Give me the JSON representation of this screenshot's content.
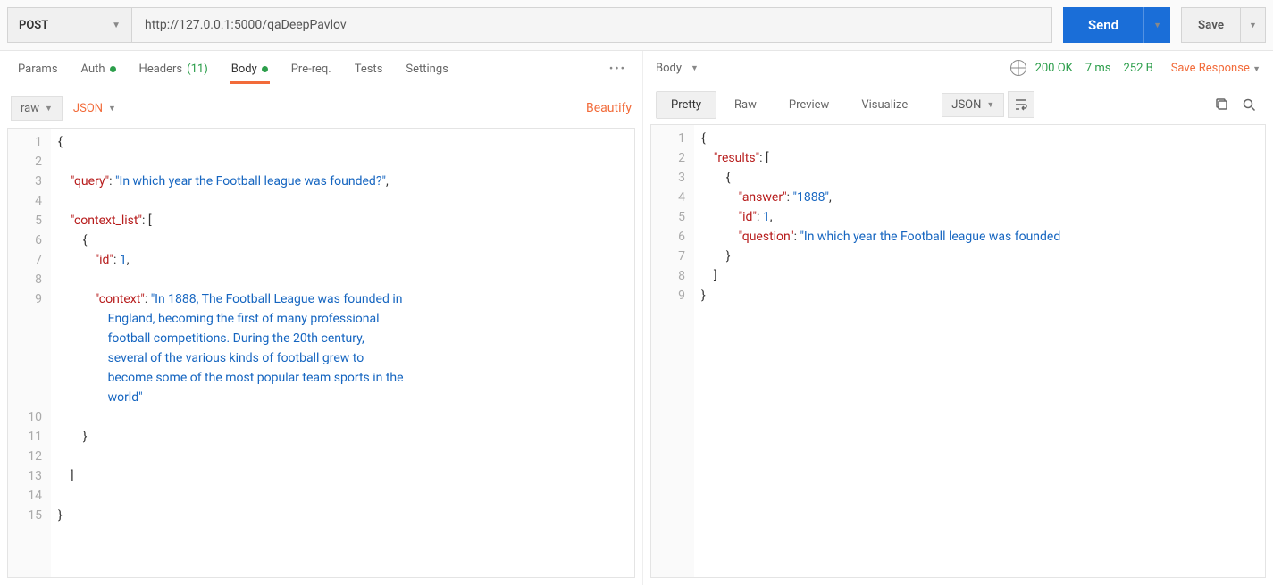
{
  "request": {
    "method": "POST",
    "url": "http://127.0.0.1:5000/qaDeepPavlov",
    "send_label": "Send",
    "save_label": "Save"
  },
  "request_tabs": {
    "items": [
      {
        "label": "Params"
      },
      {
        "label": "Auth",
        "dot": true
      },
      {
        "label": "Headers",
        "count": "(11)"
      },
      {
        "label": "Body",
        "dot": true,
        "active": true
      },
      {
        "label": "Pre-req."
      },
      {
        "label": "Tests"
      },
      {
        "label": "Settings"
      }
    ]
  },
  "request_subbar": {
    "mode": "raw",
    "format": "JSON",
    "beautify": "Beautify"
  },
  "request_body": {
    "lines": [
      "1",
      "2",
      "3",
      "4",
      "5",
      "6",
      "7",
      "8",
      "9",
      "10",
      "11",
      "12",
      "13",
      "14",
      "15"
    ],
    "content": [
      {
        "indent": 0,
        "t": [
          [
            "p",
            "{"
          ]
        ]
      },
      {
        "indent": 0,
        "t": []
      },
      {
        "indent": 1,
        "t": [
          [
            "k",
            "\"query\""
          ],
          [
            "p",
            ": "
          ],
          [
            "s",
            "\"In which year the Football league was founded?\""
          ],
          [
            "p",
            ","
          ]
        ]
      },
      {
        "indent": 0,
        "t": []
      },
      {
        "indent": 1,
        "t": [
          [
            "k",
            "\"context_list\""
          ],
          [
            "p",
            ": ["
          ]
        ]
      },
      {
        "indent": 2,
        "t": [
          [
            "p",
            "{"
          ]
        ]
      },
      {
        "indent": 3,
        "t": [
          [
            "k",
            "\"id\""
          ],
          [
            "p",
            ": "
          ],
          [
            "n",
            "1"
          ],
          [
            "p",
            ","
          ]
        ]
      },
      {
        "indent": 0,
        "t": []
      },
      {
        "indent": 3,
        "t": [
          [
            "k",
            "\"context\""
          ],
          [
            "p",
            ": "
          ],
          [
            "s",
            "\"In 1888, The Football League was founded in"
          ]
        ]
      },
      {
        "indent": 4,
        "t": [
          [
            "s",
            "England, becoming the first of many professional"
          ]
        ]
      },
      {
        "indent": 4,
        "t": [
          [
            "s",
            "football competitions. During the 20th century,"
          ]
        ]
      },
      {
        "indent": 4,
        "t": [
          [
            "s",
            "several of the various kinds of football grew to"
          ]
        ]
      },
      {
        "indent": 4,
        "t": [
          [
            "s",
            "become some of the most popular team sports in the"
          ]
        ]
      },
      {
        "indent": 4,
        "t": [
          [
            "s",
            "world\""
          ]
        ]
      },
      {
        "indent": 0,
        "t": []
      },
      {
        "indent": 2,
        "t": [
          [
            "p",
            "}"
          ]
        ]
      },
      {
        "indent": 0,
        "t": []
      },
      {
        "indent": 1,
        "t": [
          [
            "p",
            "]"
          ]
        ]
      },
      {
        "indent": 0,
        "t": []
      },
      {
        "indent": 0,
        "t": [
          [
            "p",
            "}"
          ]
        ]
      }
    ]
  },
  "response": {
    "header_label": "Body",
    "status_code": "200 OK",
    "time": "7 ms",
    "size": "252 B",
    "save_response": "Save Response"
  },
  "response_tabs": {
    "items": [
      {
        "label": "Pretty",
        "active": true
      },
      {
        "label": "Raw"
      },
      {
        "label": "Preview"
      },
      {
        "label": "Visualize"
      }
    ],
    "format": "JSON"
  },
  "response_body": {
    "lines": [
      "1",
      "2",
      "3",
      "4",
      "5",
      "6",
      "7",
      "8",
      "9"
    ],
    "content": [
      {
        "indent": 0,
        "t": [
          [
            "p",
            "{"
          ]
        ]
      },
      {
        "indent": 1,
        "t": [
          [
            "k",
            "\"results\""
          ],
          [
            "p",
            ": ["
          ]
        ]
      },
      {
        "indent": 2,
        "t": [
          [
            "p",
            "{"
          ]
        ]
      },
      {
        "indent": 3,
        "t": [
          [
            "k",
            "\"answer\""
          ],
          [
            "p",
            ": "
          ],
          [
            "s",
            "\"1888\""
          ],
          [
            "p",
            ","
          ]
        ]
      },
      {
        "indent": 3,
        "t": [
          [
            "k",
            "\"id\""
          ],
          [
            "p",
            ": "
          ],
          [
            "n",
            "1"
          ],
          [
            "p",
            ","
          ]
        ]
      },
      {
        "indent": 3,
        "t": [
          [
            "k",
            "\"question\""
          ],
          [
            "p",
            ": "
          ],
          [
            "s",
            "\"In which year the Football league was founded"
          ]
        ]
      },
      {
        "indent": 2,
        "t": [
          [
            "p",
            "}"
          ]
        ]
      },
      {
        "indent": 1,
        "t": [
          [
            "p",
            "]"
          ]
        ]
      },
      {
        "indent": 0,
        "t": [
          [
            "p",
            "}"
          ]
        ]
      }
    ]
  }
}
